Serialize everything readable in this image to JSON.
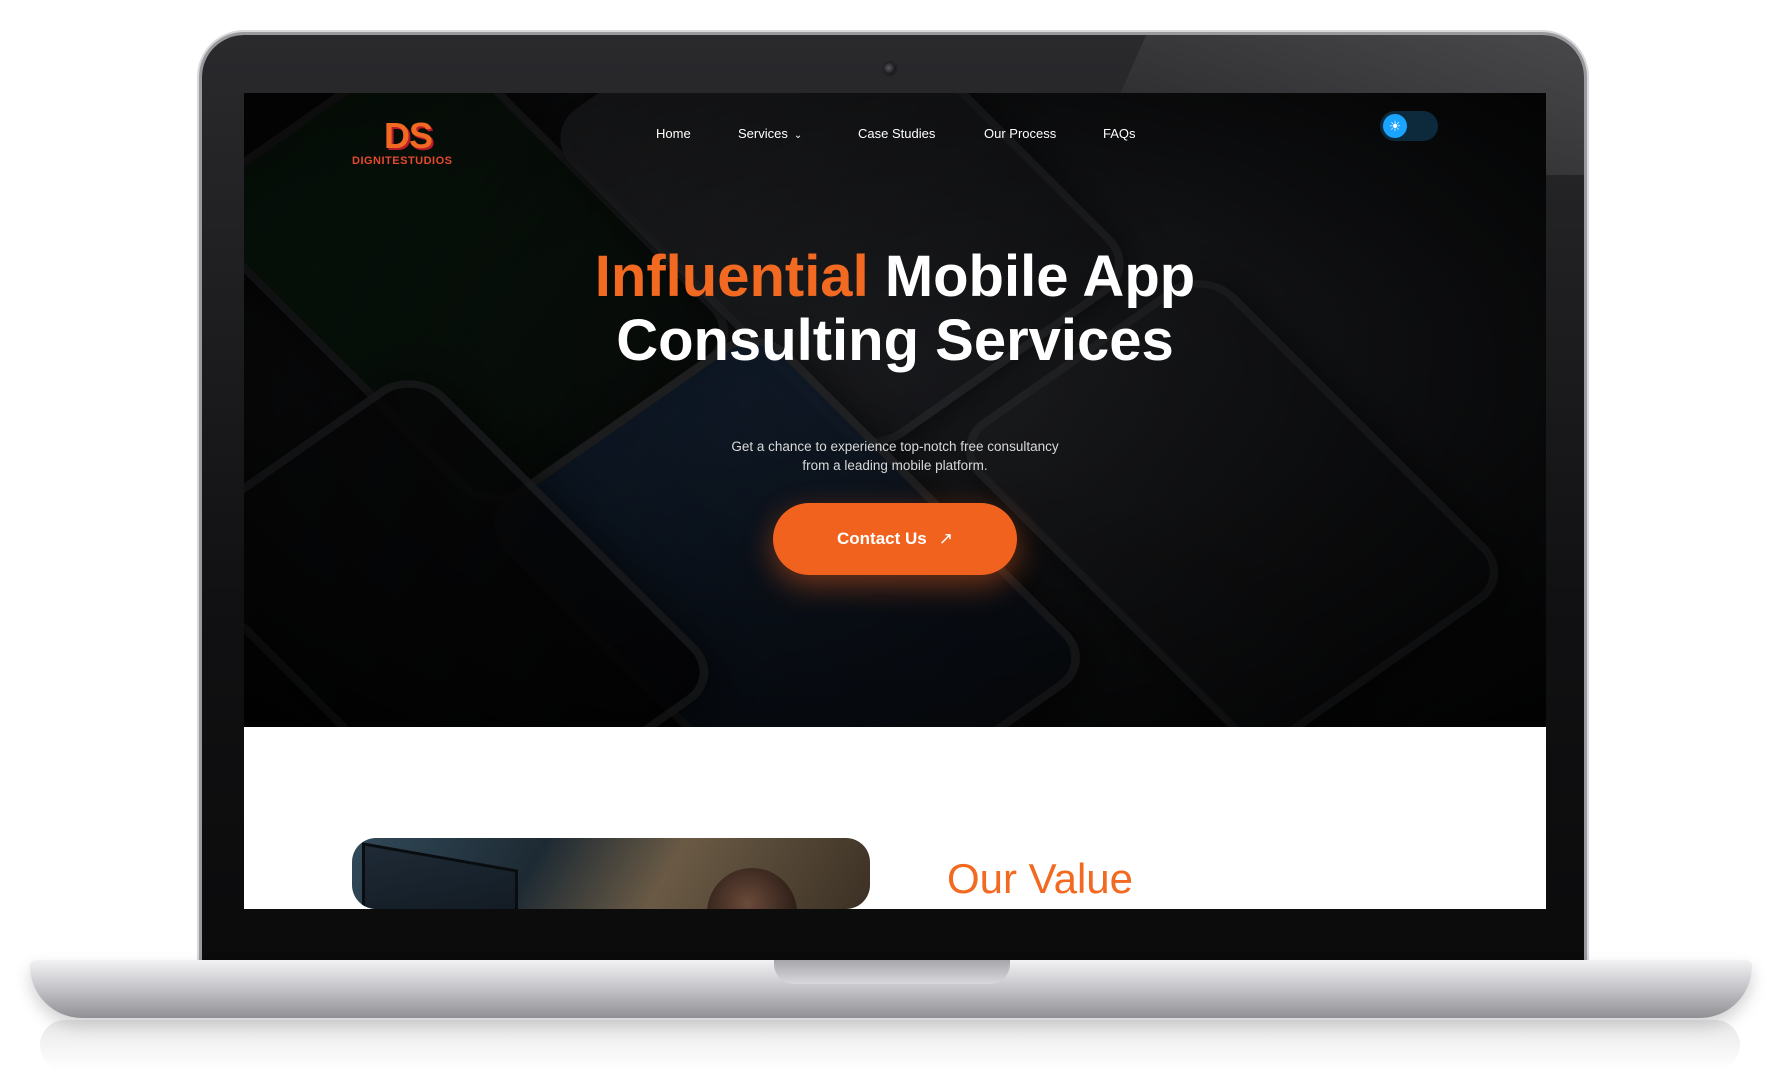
{
  "brand": {
    "logo_mark": "DS",
    "logo_text": "DIGNITESTUDIOS",
    "accent_color": "#f26a21"
  },
  "nav": {
    "items": [
      "Home",
      "Services",
      "Case Studies",
      "Our Process",
      "FAQs"
    ],
    "services_chevron": "chevron-down-icon"
  },
  "theme_toggle": {
    "icon": "sun-icon",
    "icon_glyph": "☀"
  },
  "hero": {
    "headline_accent": "Influential",
    "headline_rest_line1": "Mobile App",
    "headline_line2": "Consulting Services",
    "subtext_line1": "Get a chance to experience top-notch free consultancy",
    "subtext_line2": "from a leading mobile platform.",
    "cta_label": "Contact Us",
    "cta_icon": "arrow-up-right-icon",
    "cta_arrow_glyph": "↗"
  },
  "value_section": {
    "title": "Our Value"
  }
}
